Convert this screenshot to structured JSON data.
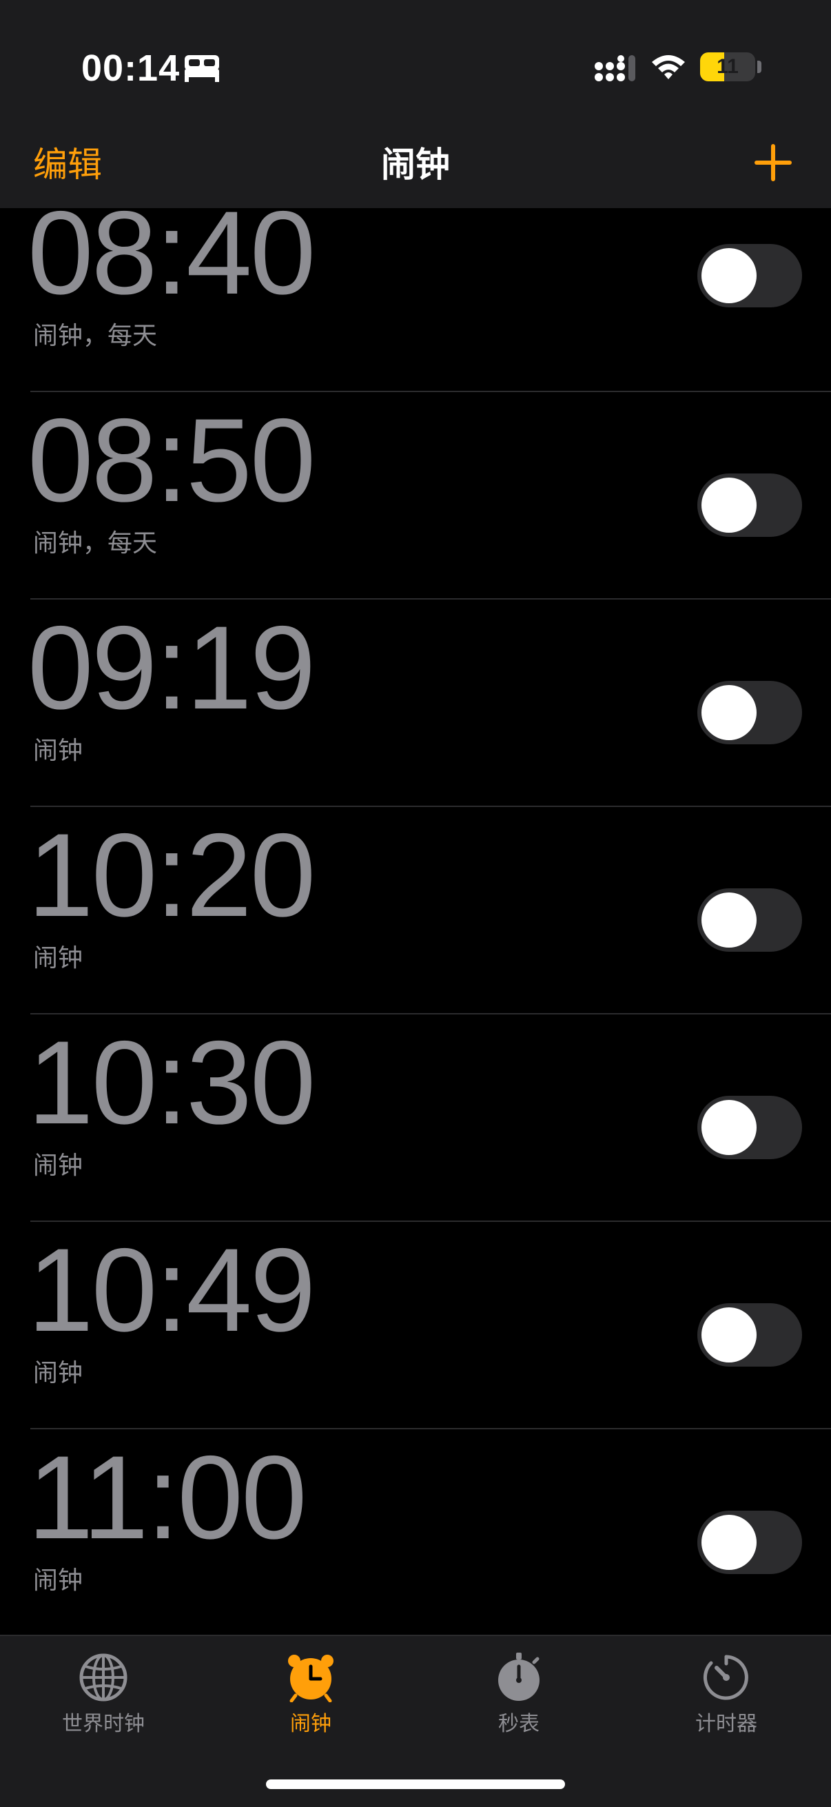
{
  "status_bar": {
    "time": "00:14",
    "battery_text": "11",
    "battery_level": 0.11,
    "icons": [
      "bed-icon",
      "signal-icon",
      "wifi-icon",
      "battery-icon"
    ]
  },
  "nav": {
    "edit_label": "编辑",
    "title": "闹钟",
    "add_icon": "plus-icon"
  },
  "colors": {
    "accent": "#ff9f0a",
    "background": "#000000",
    "bar_background": "#1c1c1e",
    "inactive_text": "#8e8e93",
    "toggle_off_track": "#2c2c2e"
  },
  "alarms": [
    {
      "time": "08:40",
      "label": "闹钟，每天",
      "enabled": false
    },
    {
      "time": "08:50",
      "label": "闹钟，每天",
      "enabled": false
    },
    {
      "time": "09:19",
      "label": "闹钟",
      "enabled": false
    },
    {
      "time": "10:20",
      "label": "闹钟",
      "enabled": false
    },
    {
      "time": "10:30",
      "label": "闹钟",
      "enabled": false
    },
    {
      "time": "10:49",
      "label": "闹钟",
      "enabled": false
    },
    {
      "time": "11:00",
      "label": "闹钟",
      "enabled": false
    }
  ],
  "tabs": [
    {
      "label": "世界时钟",
      "icon": "globe-icon",
      "active": false
    },
    {
      "label": "闹钟",
      "icon": "alarm-clock-icon",
      "active": true
    },
    {
      "label": "秒表",
      "icon": "stopwatch-icon",
      "active": false
    },
    {
      "label": "计时器",
      "icon": "timer-icon",
      "active": false
    }
  ]
}
